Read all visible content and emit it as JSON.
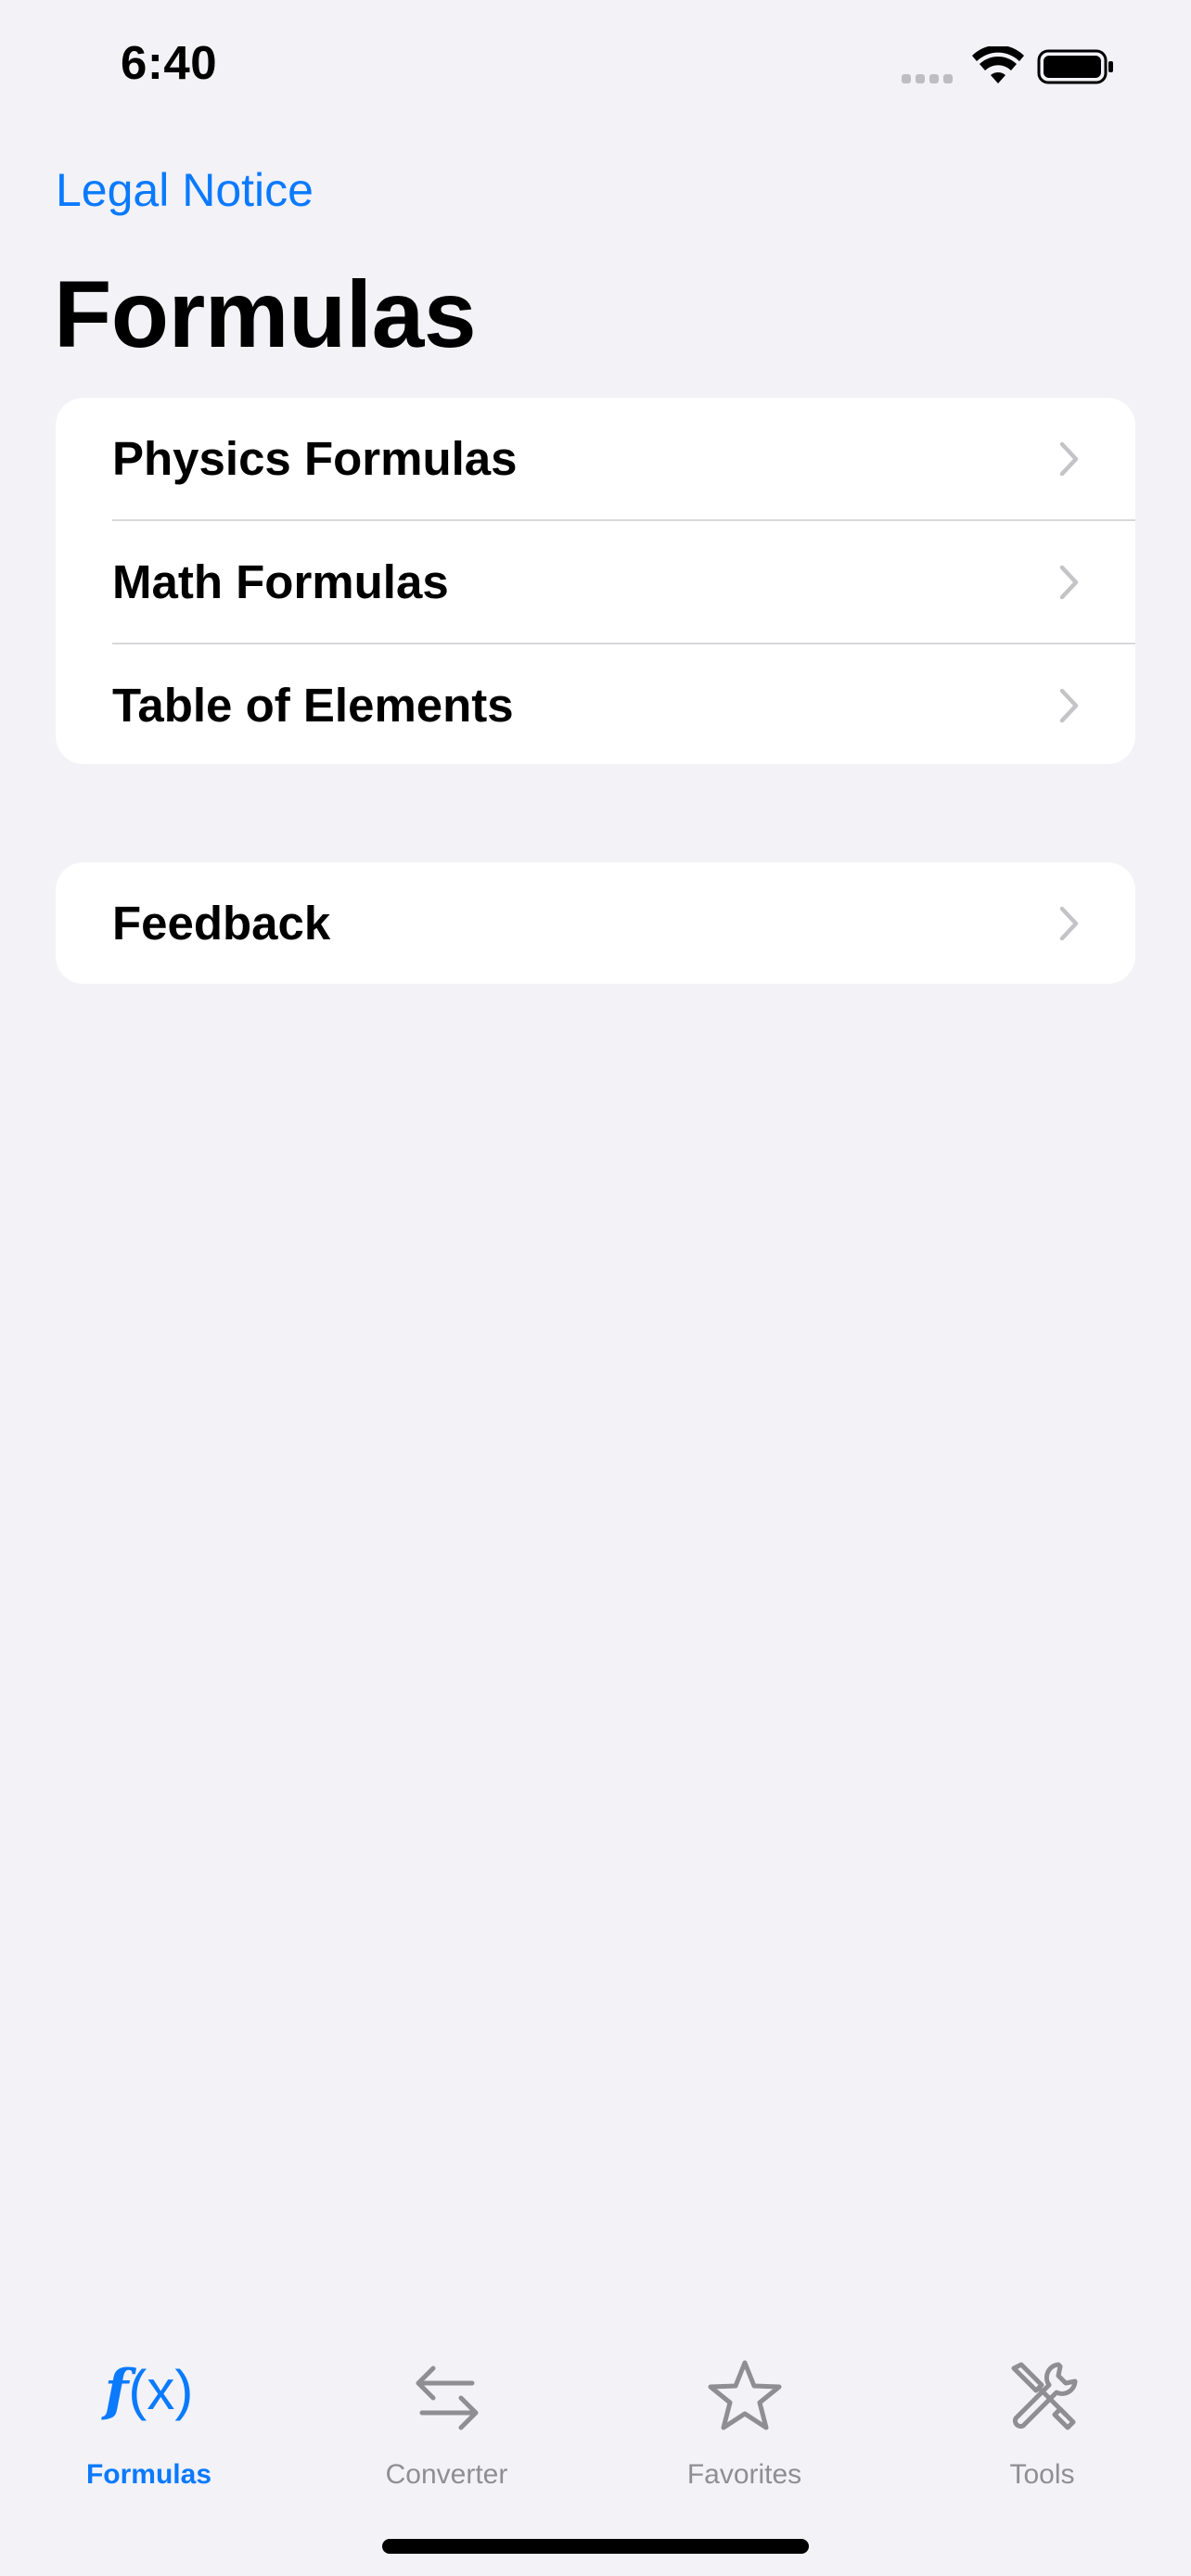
{
  "status_bar": {
    "time": "6:40"
  },
  "nav": {
    "legal_link": "Legal Notice",
    "title": "Formulas"
  },
  "groups": {
    "formulas": [
      {
        "label": "Physics Formulas"
      },
      {
        "label": "Math Formulas"
      },
      {
        "label": "Table of Elements"
      }
    ],
    "other": [
      {
        "label": "Feedback"
      }
    ]
  },
  "tab_bar": {
    "tabs": [
      {
        "label": "Formulas",
        "icon": "function-icon",
        "active": true
      },
      {
        "label": "Converter",
        "icon": "arrows-left-right-icon",
        "active": false
      },
      {
        "label": "Favorites",
        "icon": "star-icon",
        "active": false
      },
      {
        "label": "Tools",
        "icon": "wrench-screwdriver-icon",
        "active": false
      }
    ]
  },
  "colors": {
    "background": "#F2F2F7",
    "accent": "#0A7AFF",
    "inactive": "#8E8E93",
    "card": "#FFFFFF"
  }
}
